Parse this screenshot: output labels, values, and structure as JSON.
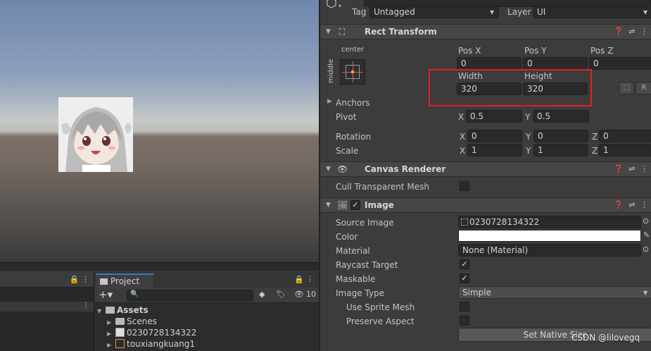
{
  "inspector": {
    "tag_label": "Tag",
    "tag_value": "Untagged",
    "layer_label": "Layer",
    "layer_value": "UI",
    "rect_transform": {
      "title": "Rect Transform",
      "anchor_top": "center",
      "anchor_side": "middle",
      "pos_x_label": "Pos X",
      "pos_x": "0",
      "pos_y_label": "Pos Y",
      "pos_y": "0",
      "pos_z_label": "Pos Z",
      "pos_z": "0",
      "width_label": "Width",
      "width": "320",
      "height_label": "Height",
      "height": "320",
      "r_button": "R",
      "anchors_label": "Anchors",
      "pivot_label": "Pivot",
      "pivot_x": "0.5",
      "pivot_y": "0.5",
      "rotation_label": "Rotation",
      "rot_x": "0",
      "rot_y": "0",
      "rot_z": "0",
      "scale_label": "Scale",
      "scale_x": "1",
      "scale_y": "1",
      "scale_z": "1",
      "axis_x": "X",
      "axis_y": "Y",
      "axis_z": "Z"
    },
    "canvas_renderer": {
      "title": "Canvas Renderer",
      "cull_label": "Cull Transparent Mesh"
    },
    "image": {
      "title": "Image",
      "source_label": "Source Image",
      "source_value": "0230728134322",
      "color_label": "Color",
      "material_label": "Material",
      "material_value": "None (Material)",
      "raycast_label": "Raycast Target",
      "maskable_label": "Maskable",
      "image_type_label": "Image Type",
      "image_type_value": "Simple",
      "use_sprite_mesh_label": "Use Sprite Mesh",
      "preserve_aspect_label": "Preserve Aspect",
      "native_size_button": "Set Native Size"
    }
  },
  "project": {
    "tab_label": "Project",
    "hidden_count": "10",
    "tree": {
      "assets": "Assets",
      "scenes": "Scenes",
      "image_asset": "0230728134322",
      "frame_asset": "touxiangkuang1"
    }
  },
  "watermark": "CSDN @lilovegq"
}
